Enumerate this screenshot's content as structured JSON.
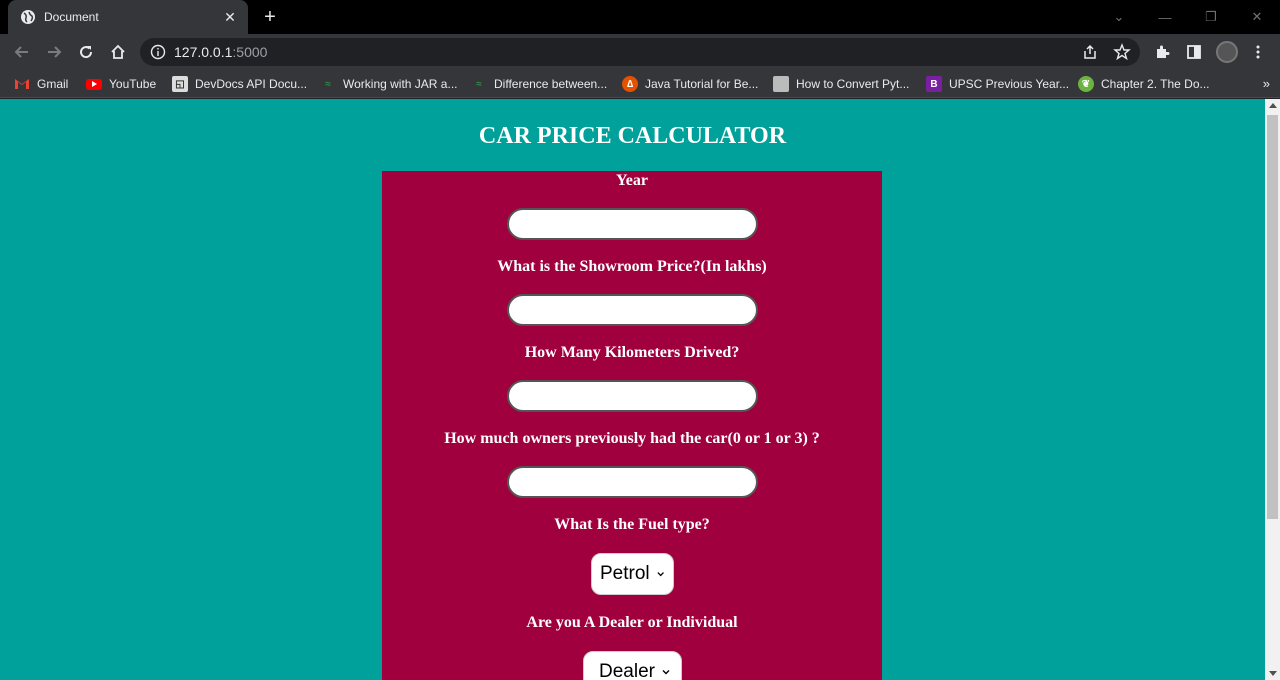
{
  "browser": {
    "tab_title": "Document",
    "new_tab": "+",
    "url_host": "127.0.0.1",
    "url_port": ":5000",
    "bookmarks": [
      {
        "label": "Gmail",
        "icon": "gmail-icon",
        "color": "#ea4335"
      },
      {
        "label": "YouTube",
        "icon": "youtube-icon",
        "color": "#ff0000"
      },
      {
        "label": "DevDocs API Docu...",
        "icon": "devdocs-icon",
        "color": "#dddddd"
      },
      {
        "label": "Working with JAR a...",
        "icon": "geeksforgeeks-icon",
        "color": "#2f8d46"
      },
      {
        "label": "Difference between...",
        "icon": "geeksforgeeks-icon",
        "color": "#2f8d46"
      },
      {
        "label": "Java Tutorial for Be...",
        "icon": "tutorial-icon",
        "color": "#e65100"
      },
      {
        "label": "How to Convert Pyt...",
        "icon": "page-icon",
        "color": "#bbbbbb"
      },
      {
        "label": "UPSC Previous Year...",
        "icon": "upsc-icon",
        "color": "#7b1fa2"
      },
      {
        "label": "Chapter 2. The Do...",
        "icon": "spring-icon",
        "color": "#6db33f"
      }
    ],
    "more_bookmarks": "»"
  },
  "page": {
    "heading": "CAR PRICE CALCULATOR",
    "background": "#00a19a",
    "form_background": "#a0003d",
    "fields": {
      "year_label": "Year",
      "showroom_label": "What is the Showroom Price?(In lakhs)",
      "km_label": "How Many Kilometers Drived?",
      "owners_label": "How much owners previously had the car(0 or 1 or 3) ?",
      "fuel_label": "What Is the Fuel type?",
      "fuel_value": "Petrol",
      "seller_label": "Are you A Dealer or Individual",
      "seller_value": "Dealer"
    }
  }
}
